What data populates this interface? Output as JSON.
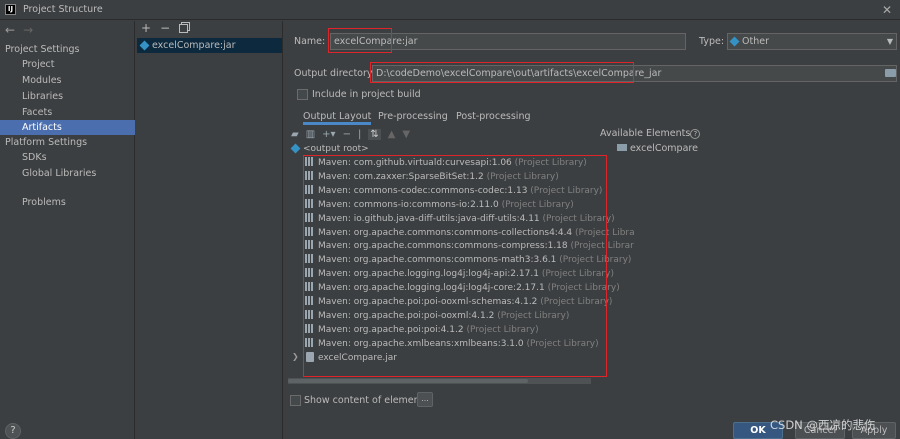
{
  "window": {
    "title": "Project Structure",
    "app_icon_text": "IJ"
  },
  "sidebar": {
    "project_settings_header": "Project Settings",
    "project_settings": [
      "Project",
      "Modules",
      "Libraries",
      "Facets",
      "Artifacts"
    ],
    "selected": "Artifacts",
    "platform_settings_header": "Platform Settings",
    "platform_settings": [
      "SDKs",
      "Global Libraries"
    ],
    "problems": "Problems",
    "help": "?"
  },
  "artifacts": {
    "toolbar": {
      "add": "+",
      "remove": "−"
    },
    "items": [
      "excelCompare:jar"
    ]
  },
  "form": {
    "name_label": "Name:",
    "name_value": "excelCompare:jar",
    "type_label": "Type:",
    "type_value": "Other",
    "output_dir_label": "Output directory:",
    "output_dir_value": "D:\\codeDemo\\excelCompare\\out\\artifacts\\excelCompare_jar",
    "include_label": "Include in project build"
  },
  "tabs": [
    "Output Layout",
    "Pre-processing",
    "Post-processing"
  ],
  "active_tab": "Output Layout",
  "tree": {
    "root": "<output root>",
    "libraries": [
      {
        "name": "Maven: com.github.virtuald:curvesapi:1.06",
        "suffix": "(Project Library)"
      },
      {
        "name": "Maven: com.zaxxer:SparseBitSet:1.2",
        "suffix": "(Project Library)"
      },
      {
        "name": "Maven: commons-codec:commons-codec:1.13",
        "suffix": "(Project Library)"
      },
      {
        "name": "Maven: commons-io:commons-io:2.11.0",
        "suffix": "(Project Library)"
      },
      {
        "name": "Maven: io.github.java-diff-utils:java-diff-utils:4.11",
        "suffix": "(Project Library)"
      },
      {
        "name": "Maven: org.apache.commons:commons-collections4:4.4",
        "suffix": "(Project Libra"
      },
      {
        "name": "Maven: org.apache.commons:commons-compress:1.18",
        "suffix": "(Project Librar"
      },
      {
        "name": "Maven: org.apache.commons:commons-math3:3.6.1",
        "suffix": "(Project Library)"
      },
      {
        "name": "Maven: org.apache.logging.log4j:log4j-api:2.17.1",
        "suffix": "(Project Library)"
      },
      {
        "name": "Maven: org.apache.logging.log4j:log4j-core:2.17.1",
        "suffix": "(Project Library)"
      },
      {
        "name": "Maven: org.apache.poi:poi-ooxml-schemas:4.1.2",
        "suffix": "(Project Library)"
      },
      {
        "name": "Maven: org.apache.poi:poi-ooxml:4.1.2",
        "suffix": "(Project Library)"
      },
      {
        "name": "Maven: org.apache.poi:poi:4.1.2",
        "suffix": "(Project Library)"
      },
      {
        "name": "Maven: org.apache.xmlbeans:xmlbeans:3.1.0",
        "suffix": "(Project Library)"
      }
    ],
    "jar": "excelCompare.jar"
  },
  "available_elements": {
    "title": "Available Elements",
    "items": [
      "excelCompare"
    ]
  },
  "show_content_label": "Show content of elements",
  "dots_label": "...",
  "buttons": {
    "ok": "OK",
    "cancel": "Cancel",
    "apply": "Apply"
  },
  "watermark": "CSDN @西凉的悲伤",
  "colors": {
    "accent": "#4b6eaf",
    "highlight_box": "#e0252a",
    "background": "#3c3f41"
  }
}
